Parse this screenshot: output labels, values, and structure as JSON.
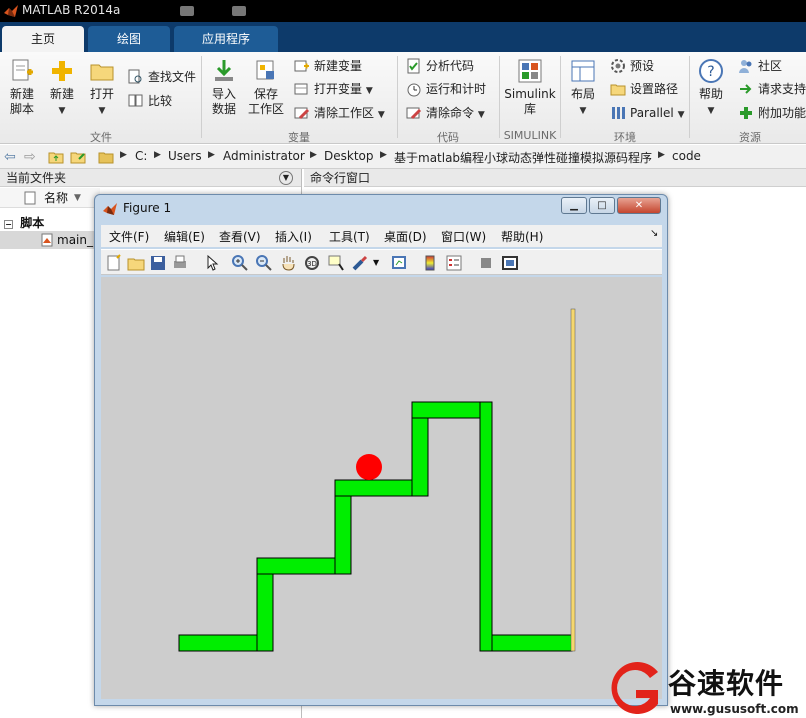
{
  "app": {
    "title": "MATLAB R2014a"
  },
  "tabs": [
    {
      "label": "主页",
      "active": true
    },
    {
      "label": "绘图",
      "active": false
    },
    {
      "label": "应用程序",
      "active": false
    }
  ],
  "ribbon": {
    "new_script": "新建\n脚本",
    "new": "新建",
    "open": "打开",
    "find_files": "查找文件",
    "compare": "比较",
    "import_data": "导入\n数据",
    "save_workspace": "保存\n工作区",
    "new_variable": "新建变量",
    "open_variable": "打开变量",
    "clear_workspace": "清除工作区",
    "analyze_code": "分析代码",
    "run_and_time": "运行和计时",
    "clear_commands": "清除命令",
    "simulink": "Simulink\n库",
    "layout": "布局",
    "preferences": "预设",
    "set_path": "设置路径",
    "parallel": "Parallel",
    "help": "帮助",
    "community": "社区",
    "request_support": "请求支持",
    "addons": "附加功能",
    "groups": {
      "file": "文件",
      "variable": "变量",
      "code": "代码",
      "simulink": "SIMULINK",
      "environment": "环境",
      "resources": "资源"
    }
  },
  "address": {
    "crumbs": [
      "C:",
      "Users",
      "Administrator",
      "Desktop",
      "基于matlab编程小球动态弹性碰撞模拟源码程序",
      "code"
    ]
  },
  "current_folder": {
    "title": "当前文件夹",
    "col_name": "名称",
    "group": "脚本",
    "file": "main_r"
  },
  "command_window": {
    "title": "命令行窗口"
  },
  "figure": {
    "title": "Figure 1",
    "menu": [
      "文件(F)",
      "编辑(E)",
      "查看(V)",
      "插入(I)",
      "工具(T)",
      "桌面(D)",
      "窗口(W)",
      "帮助(H)"
    ],
    "colors": {
      "stairs": "#00ee00",
      "ball": "#ff0000",
      "wall": "#f5d76e",
      "axes_bg": "#cdcdcd"
    },
    "ball_shown": true
  },
  "watermark": {
    "brand": "谷速软件",
    "url": "www.gususoft.com"
  }
}
